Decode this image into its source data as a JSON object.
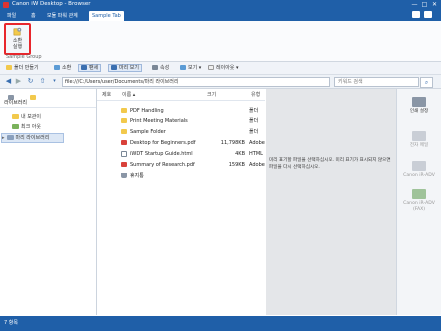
{
  "window": {
    "title": "Canon iW Desktop - Browser",
    "controls": [
      "—",
      "□",
      "✕"
    ]
  },
  "ribbon": {
    "tabs": [
      {
        "label": "파일",
        "active": false
      },
      {
        "label": "홈",
        "active": false
      },
      {
        "label": "모듈 파워 관계",
        "active": false
      },
      {
        "label": "Sample Tab",
        "active": true
      }
    ],
    "button_label_line1": "소환",
    "button_label_line2": "실행",
    "group_label": "Sample Group"
  },
  "toolbar": {
    "items": [
      {
        "label": "폴더 만들기"
      },
      {
        "label": "소환"
      },
      {
        "label": "팬세"
      },
      {
        "label": "마리 보기"
      },
      {
        "label": "속성"
      },
      {
        "label": "보기 ▾"
      },
      {
        "label": "레이아웃 ▾"
      }
    ]
  },
  "address": {
    "value": "file:///C:/Users/user/Documents/마리 라이브러리",
    "search_placeholder": "키워드 검색"
  },
  "navpane": {
    "library_label": "라이브러리",
    "items": [
      {
        "label": "내 보관이"
      },
      {
        "label": "최크 아웃"
      },
      {
        "label": "마리 라이브러리"
      }
    ]
  },
  "filelist": {
    "headers": [
      "제호",
      "이름 ▴",
      "크기",
      "유형"
    ],
    "rows": [
      {
        "name": "PDF Handling",
        "size": "",
        "type": "폴더",
        "icon": "folder-icon"
      },
      {
        "name": "Print Meeting Materials",
        "size": "",
        "type": "폴더",
        "icon": "folder-icon"
      },
      {
        "name": "Sample Folder",
        "size": "",
        "type": "폴더",
        "icon": "folder-icon"
      },
      {
        "name": "Desktop for Beginners.pdf",
        "size": "11,798KB",
        "type": "Adobe",
        "icon": "pdf-icon"
      },
      {
        "name": "iWDT Startup Guide.html",
        "size": "4KB",
        "type": "HTML",
        "icon": "html-icon"
      },
      {
        "name": "Summary of Research.pdf",
        "size": "159KB",
        "type": "Adobe",
        "icon": "pdf-icon"
      },
      {
        "name": "휴지통",
        "size": "",
        "type": "",
        "icon": "trash-icon"
      }
    ]
  },
  "preview": {
    "message": "미리 표기할 파일을 선택하십시오. 미리 표기가 표시되지 않으면 파일을 다시 선택하십시오."
  },
  "rightbar": {
    "items": [
      {
        "label": "인쇄 설정",
        "enabled": true
      },
      {
        "label": "전자 메일",
        "enabled": false
      },
      {
        "label": "Canon iR-ADV",
        "enabled": false
      },
      {
        "label": "Canon iR-ADV (FAX)",
        "enabled": false
      }
    ]
  },
  "status": {
    "text": "7 항목"
  },
  "colors": {
    "accent": "#1f5fa8",
    "highlight_border": "#e8262c",
    "preview_bg": "#e4e6e9"
  }
}
